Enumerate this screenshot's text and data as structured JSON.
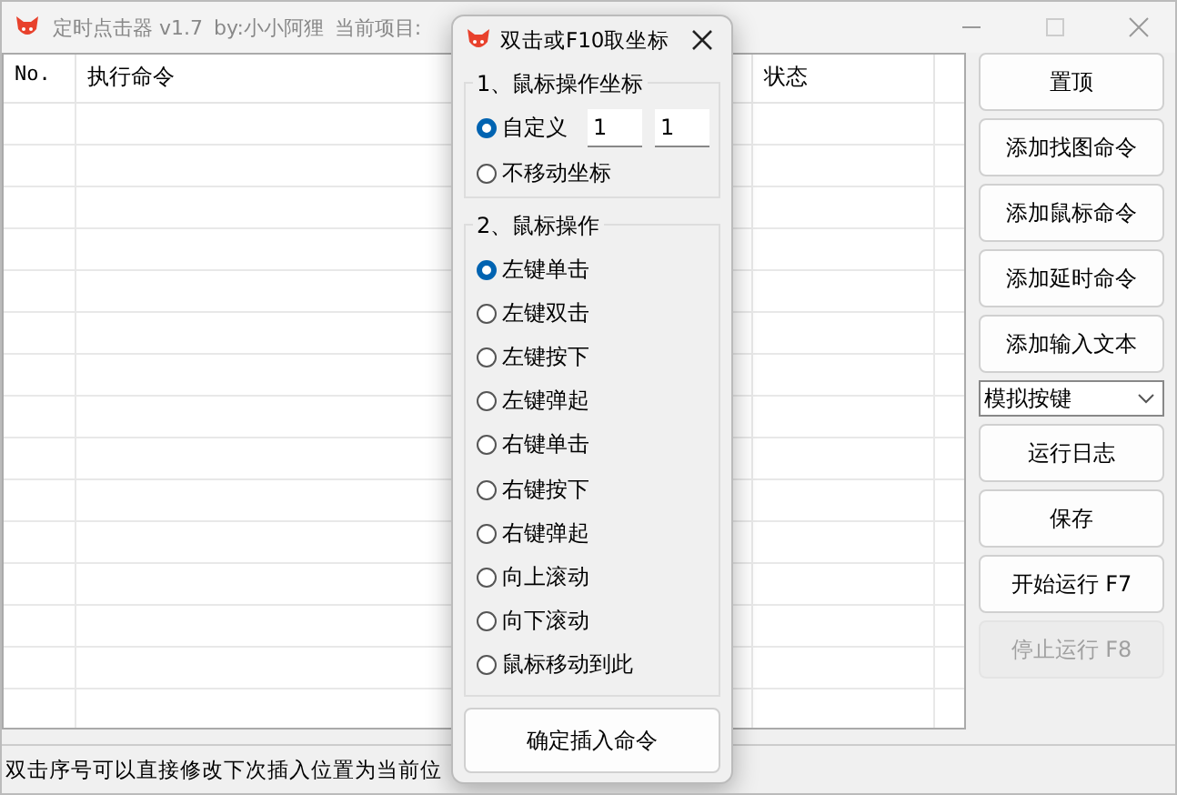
{
  "window": {
    "title": "定时点击器 v1.7",
    "author": "by:小小阿狸",
    "project_label": "当前项目:"
  },
  "table": {
    "columns": [
      "No.",
      "执行命令",
      "状态"
    ]
  },
  "side_buttons": [
    {
      "label": "置顶",
      "disabled": false
    },
    {
      "label": "添加找图命令",
      "disabled": false
    },
    {
      "label": "添加鼠标命令",
      "disabled": false
    },
    {
      "label": "添加延时命令",
      "disabled": false
    },
    {
      "label": "添加输入文本",
      "disabled": false
    },
    {
      "kind": "dropdown",
      "label": "模拟按键"
    },
    {
      "label": "运行日志",
      "disabled": false
    },
    {
      "label": "保存",
      "disabled": false
    },
    {
      "label": "开始运行 F7",
      "disabled": false
    },
    {
      "label": "停止运行 F8",
      "disabled": true
    }
  ],
  "status_bar": "双击序号可以直接修改下次插入位置为当前位",
  "dialog": {
    "title": "双击或F10取坐标",
    "coord_group": {
      "title": "1、鼠标操作坐标",
      "options": [
        {
          "label": "自定义",
          "selected": true,
          "inputs": [
            "1",
            "1"
          ]
        },
        {
          "label": "不移动坐标",
          "selected": false
        }
      ]
    },
    "action_group": {
      "title": "2、鼠标操作",
      "options": [
        {
          "label": "左键单击",
          "selected": true
        },
        {
          "label": "左键双击",
          "selected": false
        },
        {
          "label": "左键按下",
          "selected": false
        },
        {
          "label": "左键弹起",
          "selected": false
        },
        {
          "label": "右键单击",
          "selected": false
        },
        {
          "label": "右键按下",
          "selected": false
        },
        {
          "label": "右键弹起",
          "selected": false
        },
        {
          "label": "向上滚动",
          "selected": false
        },
        {
          "label": "向下滚动",
          "selected": false
        },
        {
          "label": "鼠标移动到此",
          "selected": false
        }
      ]
    },
    "confirm_button": "确定插入命令"
  }
}
